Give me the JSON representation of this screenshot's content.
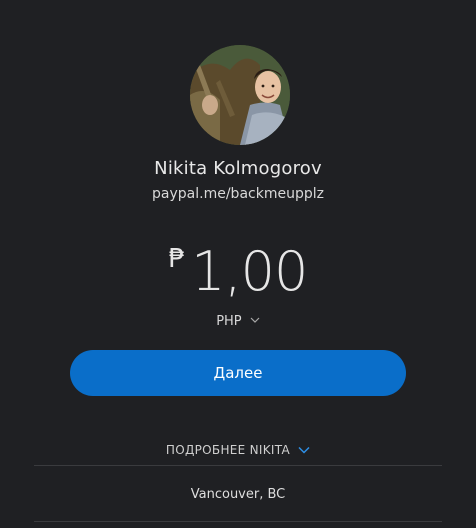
{
  "profile": {
    "name": "Nikita Kolmogorov",
    "link": "paypal.me/backmeupplz",
    "avatar_icon": "profile-photo"
  },
  "payment": {
    "currency_symbol": "₱",
    "amount": "1,00",
    "currency_code": "PHP"
  },
  "actions": {
    "next_label": "Далее",
    "more_label": "ПОДРОБНЕЕ NIKITA"
  },
  "details": {
    "location": "Vancouver, BC"
  },
  "colors": {
    "background": "#1f2023",
    "button": "#0a6ec9",
    "accent_chevron": "#2e8fe6"
  }
}
